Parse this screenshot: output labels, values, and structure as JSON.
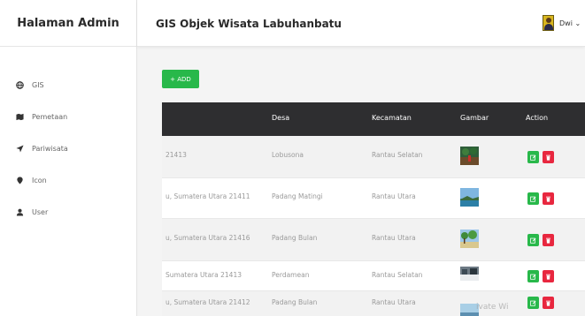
{
  "sidebar": {
    "brand": "Halaman Admin",
    "items": [
      {
        "label": "GIS",
        "icon": "globe-icon"
      },
      {
        "label": "Pemetaan",
        "icon": "map-icon"
      },
      {
        "label": "Pariwisata",
        "icon": "location-arrow-icon"
      },
      {
        "label": "Icon",
        "icon": "map-marker-icon"
      },
      {
        "label": "User",
        "icon": "user-icon"
      }
    ]
  },
  "header": {
    "title": "GIS Objek Wisata Labuhanbatu",
    "user_name": "Dwi",
    "user_caret": "⌄"
  },
  "toolbar": {
    "add_label": "+ ADD"
  },
  "table": {
    "columns": [
      "Desa",
      "Kecamatan",
      "Gambar",
      "Action"
    ],
    "rows": [
      {
        "alamat": "21413",
        "desa": "Lobusona",
        "kecamatan": "Rantau Selatan"
      },
      {
        "alamat": "u, Sumatera Utara 21411",
        "desa": "Padang Matingi",
        "kecamatan": "Rantau Utara"
      },
      {
        "alamat": "u, Sumatera Utara 21416",
        "desa": "Padang Bulan",
        "kecamatan": "Rantau Utara"
      },
      {
        "alamat": "Sumatera Utara 21413",
        "desa": "Perdamean",
        "kecamatan": "Rantau Selatan"
      },
      {
        "alamat": "u, Sumatera Utara 21412",
        "desa": "Padang Bulan",
        "kecamatan": "Rantau Utara"
      }
    ]
  },
  "watermark": "ivate Wi",
  "colors": {
    "accent_green": "#28b84a",
    "danger_red": "#e8273f",
    "table_header": "#2e2e30"
  }
}
